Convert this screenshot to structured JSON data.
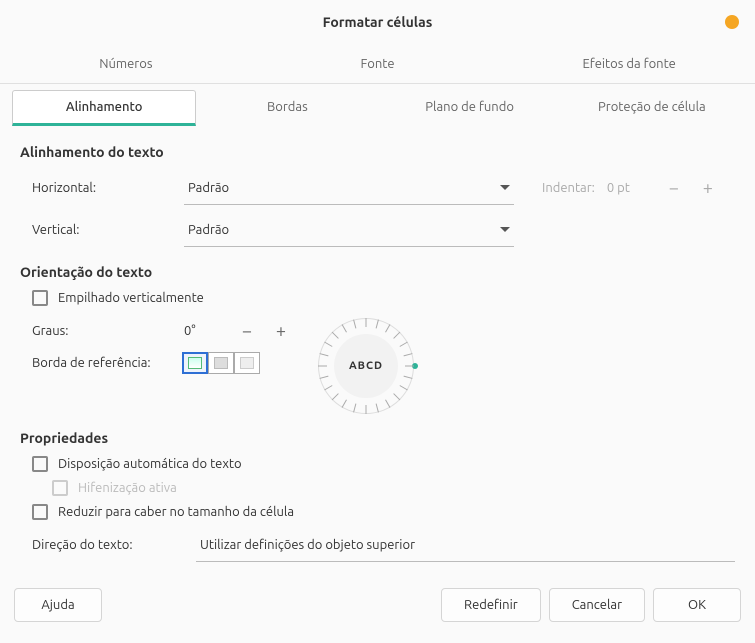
{
  "title": "Formatar células",
  "tabs_upper": [
    "Números",
    "Fonte",
    "Efeitos da fonte"
  ],
  "tabs_lower": [
    "Alinhamento",
    "Bordas",
    "Plano de fundo",
    "Proteção de célula"
  ],
  "active_lower_tab": 0,
  "sections": {
    "text_align": {
      "title": "Alinhamento do texto",
      "horizontal_label": "Horizontal:",
      "horizontal_value": "Padrão",
      "indent_label": "Indentar:",
      "indent_value": "0 pt",
      "vertical_label": "Vertical:",
      "vertical_value": "Padrão"
    },
    "orientation": {
      "title": "Orientação do texto",
      "stacked_label": "Empilhado verticalmente",
      "degrees_label": "Graus:",
      "degrees_value": "0°",
      "ref_label": "Borda de referência:",
      "dial_text": "ABCD"
    },
    "properties": {
      "title": "Propriedades",
      "wrap_label": "Disposição automática do texto",
      "hyphen_label": "Hifenização ativa",
      "shrink_label": "Reduzir para caber no tamanho da célula",
      "dir_label": "Direção do texto:",
      "dir_value": "Utilizar definições do objeto superior"
    }
  },
  "buttons": {
    "help": "Ajuda",
    "reset": "Redefinir",
    "cancel": "Cancelar",
    "ok": "OK"
  }
}
